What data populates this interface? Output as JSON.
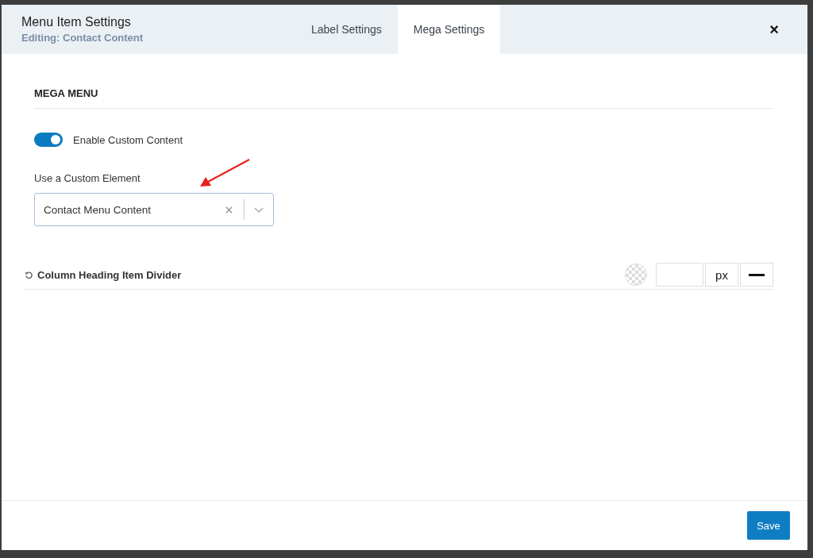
{
  "dialog": {
    "title": "Menu Item Settings",
    "subtitle": "Editing: Contact Content",
    "close": "×",
    "tabs": [
      {
        "label": "Label Settings",
        "selected": false
      },
      {
        "label": "Mega Settings",
        "selected": true
      }
    ]
  },
  "section": {
    "heading": "MEGA MENU",
    "toggle": {
      "label": "Enable Custom Content",
      "on": true
    },
    "select": {
      "label": "Use a Custom Element",
      "value": "Contact Menu Content"
    },
    "divider_setting": {
      "label": "Column Heading Item Divider",
      "unit": "px"
    }
  },
  "footer": {
    "save": "Save"
  }
}
